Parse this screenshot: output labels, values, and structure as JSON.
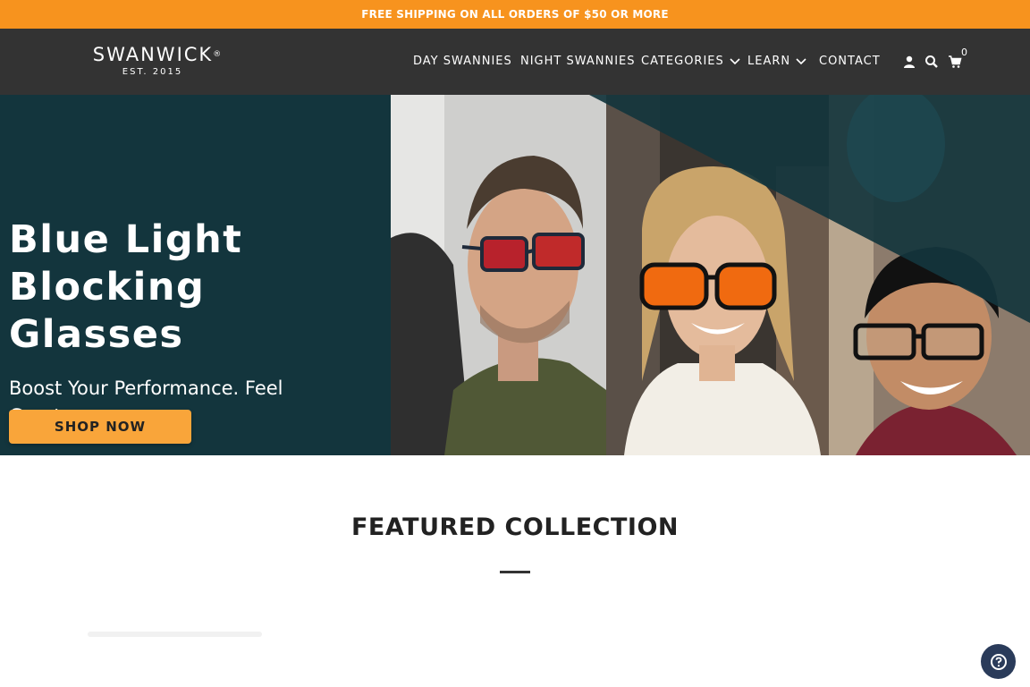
{
  "promo": {
    "text": "FREE SHIPPING ON ALL ORDERS OF $50 OR MORE"
  },
  "header": {
    "logo": {
      "name": "SWANWICK",
      "reg": "®",
      "est": "EST. 2015"
    },
    "nav": [
      {
        "label": "DAY SWANNIES"
      },
      {
        "label": "NIGHT SWANNIES"
      },
      {
        "label": "CATEGORIES",
        "dropdown": true
      },
      {
        "label": "LEARN",
        "dropdown": true
      },
      {
        "label": "CONTACT"
      }
    ],
    "icons": [
      "account-icon",
      "search-icon",
      "cart-icon"
    ],
    "cart_count": "0"
  },
  "hero": {
    "title": "Blue Light Blocking Glasses",
    "subtitle": "Boost Your Performance. Feel Great",
    "cta_label": "SHOP NOW",
    "colors": {
      "background": "#13353d",
      "button": "#f9a53a"
    },
    "photos": [
      "man-orange-lens-glasses",
      "woman-orange-lens-glasses",
      "man-clear-lens-glasses"
    ]
  },
  "featured": {
    "title": "FEATURED COLLECTION"
  },
  "help": {
    "icon": "question-icon"
  },
  "colors": {
    "promo": "#f7931e",
    "header": "#333333",
    "accent": "#f9a53a"
  }
}
